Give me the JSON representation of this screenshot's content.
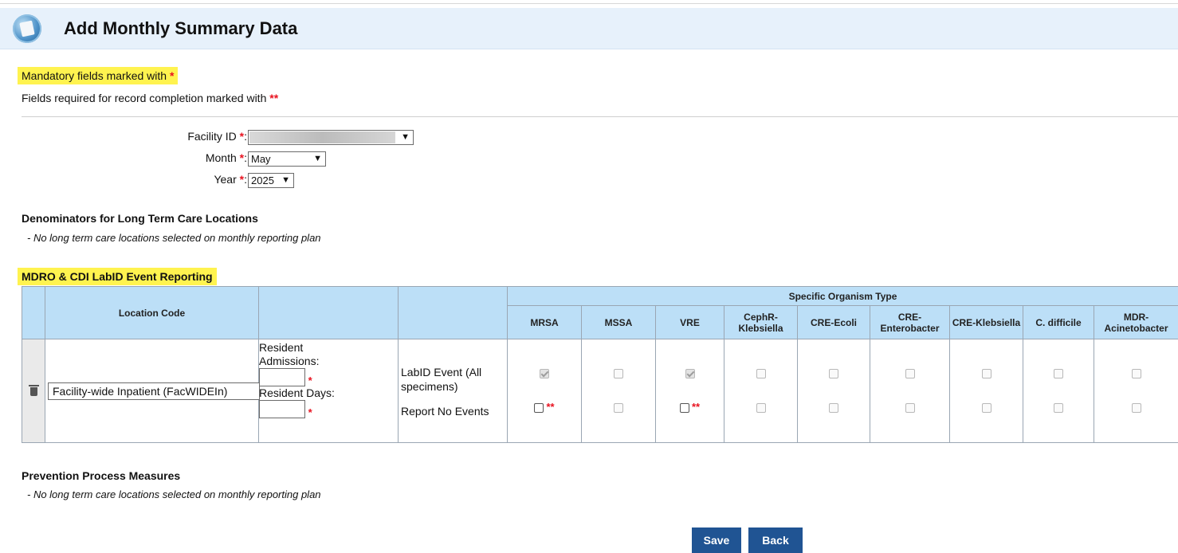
{
  "header": {
    "title": "Add Monthly Summary Data",
    "logo_icon": "nhsn-globe-icon"
  },
  "notes": {
    "mandatory": "Mandatory fields marked with",
    "completion": "Fields required for record completion marked with",
    "single_star": "*",
    "double_star": "**"
  },
  "form": {
    "facility_label": "Facility ID",
    "month_label": "Month",
    "month_value": "May",
    "year_label": "Year",
    "year_value": "2025",
    "colon": ":"
  },
  "ltc": {
    "title": "Denominators for Long Term Care Locations",
    "note": "- No long term care locations selected on monthly reporting plan"
  },
  "mdro": {
    "title": "MDRO & CDI LabID Event Reporting",
    "location_code_header": "Location Code",
    "specific_header": "Specific Organism Type",
    "organisms": [
      "MRSA",
      "MSSA",
      "VRE",
      "CephR-Klebsiella",
      "CRE-Ecoli",
      "CRE-Enterobacter",
      "CRE-Klebsiella",
      "C. difficile",
      "MDR-Acinetobacter"
    ],
    "row": {
      "location_value": "Facility-wide Inpatient (FacWIDEIn)",
      "admissions_label": "Resident Admissions:",
      "days_label": "Resident Days:",
      "labid_label": "LabID Event (All specimens)",
      "noevents_label": "Report No Events",
      "labid_checked": [
        true,
        false,
        true,
        false,
        false,
        false,
        false,
        false,
        false
      ],
      "noevents_required": [
        true,
        false,
        true,
        false,
        false,
        false,
        false,
        false,
        false
      ]
    }
  },
  "ppm": {
    "title": "Prevention Process Measures",
    "note": "- No long term care locations selected on monthly reporting plan"
  },
  "buttons": {
    "save": "Save",
    "back": "Back"
  }
}
